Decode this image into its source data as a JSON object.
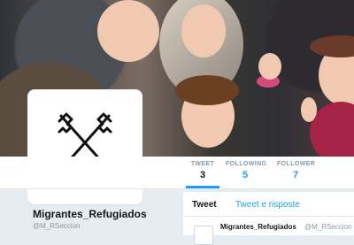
{
  "profile": {
    "name": "Migrantes_Refugiados",
    "handle": "@M_RSeccion"
  },
  "stats": [
    {
      "label": "TWEET",
      "value": "3"
    },
    {
      "label": "FOLLOWING",
      "value": "5"
    },
    {
      "label": "FOLLOWER",
      "value": "7"
    }
  ],
  "timeline": {
    "tabs": [
      "Tweet",
      "Tweet e risposte"
    ],
    "tweet": {
      "author": "Migrantes_Refugiados",
      "handle": "@M_RSeccion"
    }
  },
  "colors": {
    "accent": "#1da1f2",
    "text": "#14171a",
    "muted": "#8899a6",
    "background": "#e6ecf0"
  },
  "icons": {
    "avatar": "crossed-keys-icon"
  }
}
